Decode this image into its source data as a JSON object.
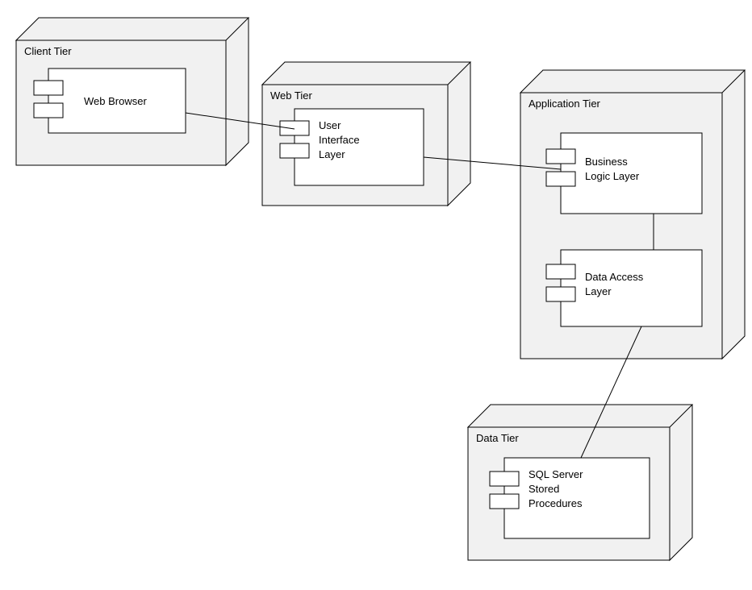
{
  "diagram": {
    "type": "uml-deployment",
    "nodes": [
      {
        "id": "client",
        "label": "Client Tier"
      },
      {
        "id": "web",
        "label": "Web Tier"
      },
      {
        "id": "application",
        "label": "Application Tier"
      },
      {
        "id": "data",
        "label": "Data Tier"
      }
    ],
    "components": [
      {
        "id": "web-browser",
        "node": "client",
        "label_lines": [
          "Web Browser"
        ]
      },
      {
        "id": "user-interface-layer",
        "node": "web",
        "label_lines": [
          "User",
          "Interface",
          "Layer"
        ]
      },
      {
        "id": "business-logic-layer",
        "node": "application",
        "label_lines": [
          "Business",
          "Logic Layer"
        ]
      },
      {
        "id": "data-access-layer",
        "node": "application",
        "label_lines": [
          "Data Access",
          "Layer"
        ]
      },
      {
        "id": "sql-server-sp",
        "node": "data",
        "label_lines": [
          "SQL Server",
          "Stored",
          "Procedures"
        ]
      }
    ],
    "connections": [
      {
        "from": "web-browser",
        "to": "user-interface-layer"
      },
      {
        "from": "user-interface-layer",
        "to": "business-logic-layer"
      },
      {
        "from": "business-logic-layer",
        "to": "data-access-layer"
      },
      {
        "from": "data-access-layer",
        "to": "sql-server-sp"
      }
    ]
  }
}
